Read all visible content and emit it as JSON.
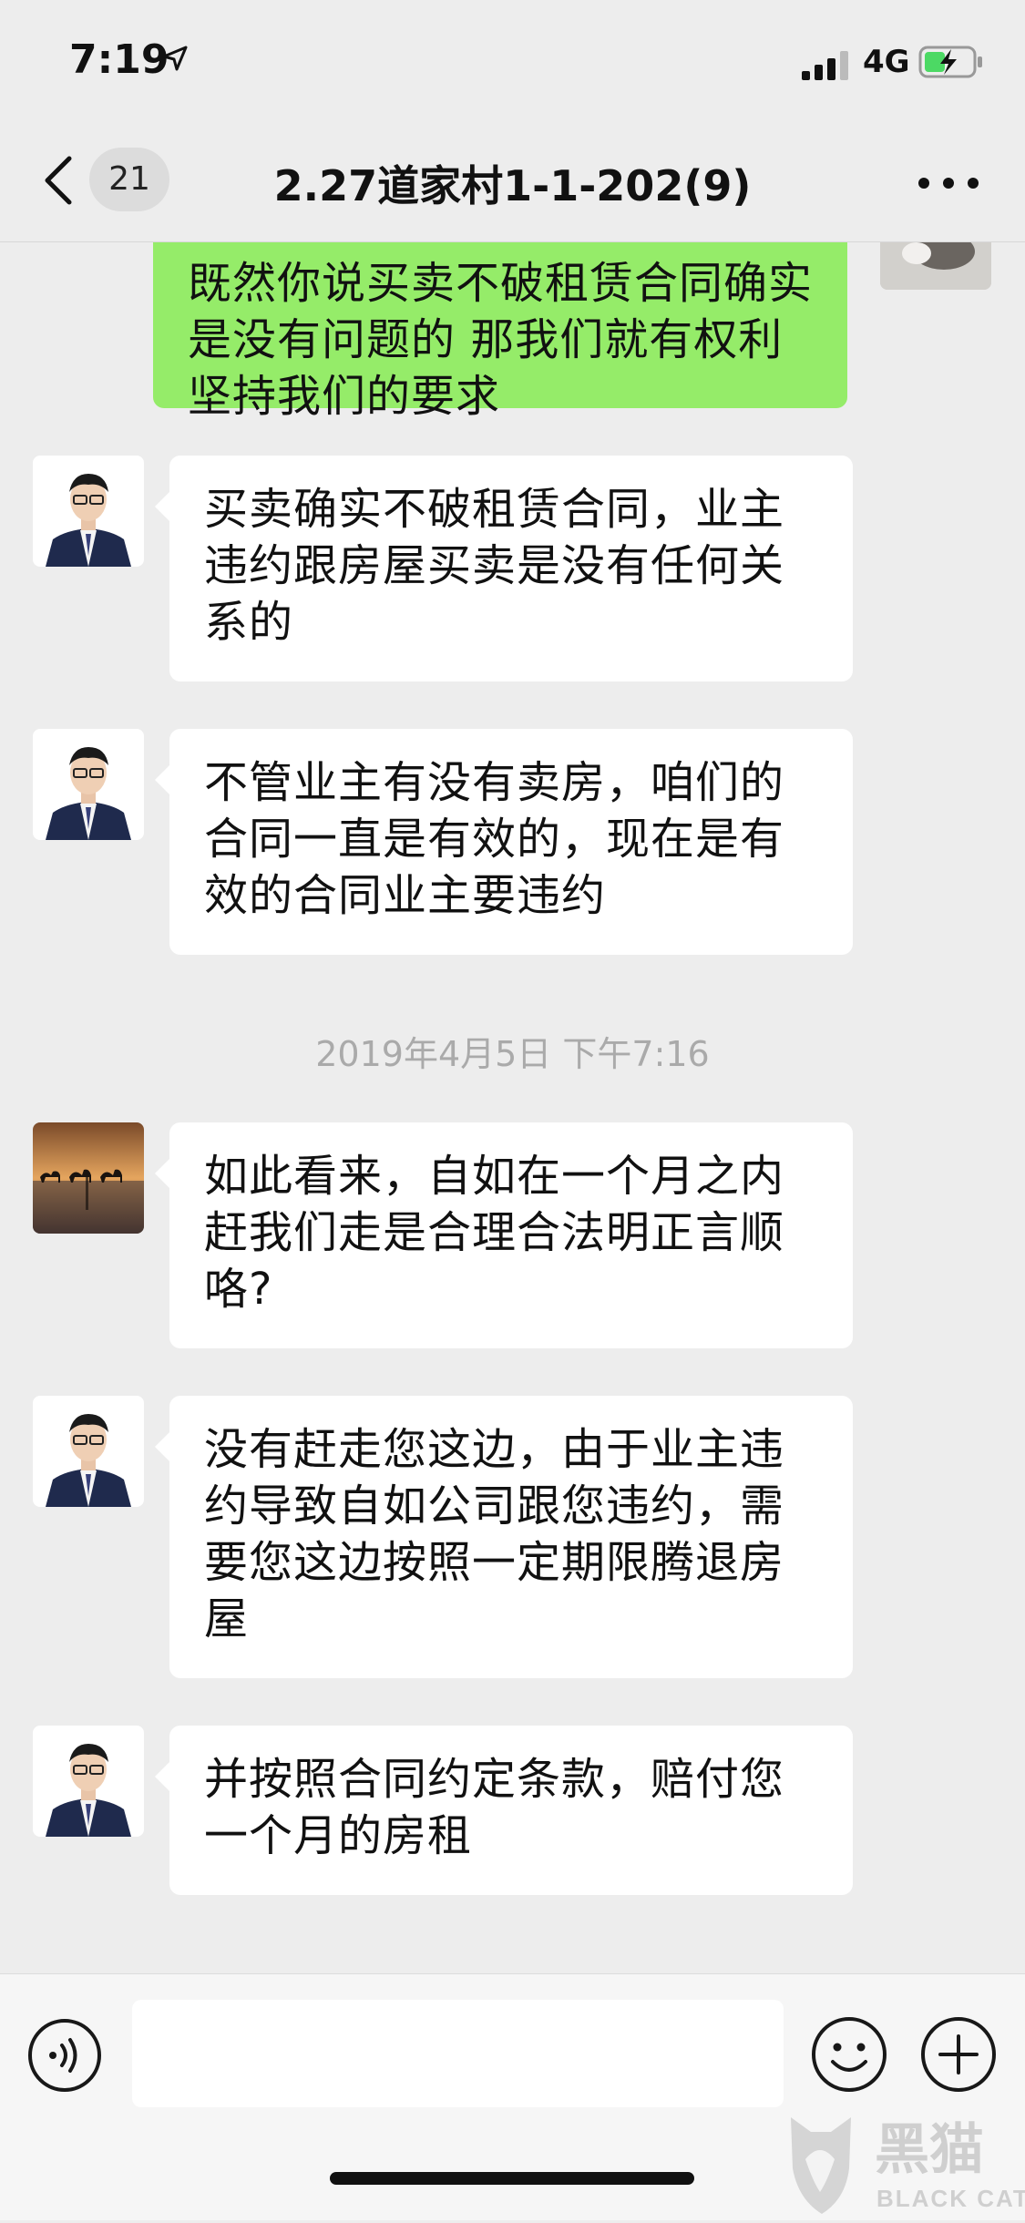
{
  "status_bar": {
    "time": "7:19",
    "network": "4G"
  },
  "nav": {
    "unread_count": "21",
    "title": "2.27道家村1-1-202(9)"
  },
  "messages": [
    {
      "side": "out",
      "text": "既然你说买卖不破租赁合同确实是没有问题的 那我们就有权利坚持我们的要求"
    },
    {
      "side": "in",
      "avatar": "agent",
      "text": "买卖确实不破租赁合同，业主违约跟房屋买卖是没有任何关系的"
    },
    {
      "side": "in",
      "avatar": "agent",
      "text": "不管业主有没有卖房，咱们的合同一直是有效的，现在是有效的合同业主要违约"
    },
    {
      "side": "in",
      "avatar": "camels",
      "text": "如此看来，自如在一个月之内赶我们走是合理合法明正言顺咯?"
    },
    {
      "side": "in",
      "avatar": "agent",
      "text": "没有赶走您这边，由于业主违约导致自如公司跟您违约，需要您这边按照一定期限腾退房屋"
    },
    {
      "side": "in",
      "avatar": "agent",
      "text": "并按照合同约定条款，赔付您一个月的房租"
    }
  ],
  "timestamp": "2019年4月5日 下午7:16",
  "watermark": {
    "text": "黑猫",
    "sub": "BLACK CAT"
  },
  "colors": {
    "bg": "#ededed",
    "outgoing_bubble": "#95ec69",
    "incoming_bubble": "#ffffff",
    "timestamp": "#aaaaaa"
  }
}
